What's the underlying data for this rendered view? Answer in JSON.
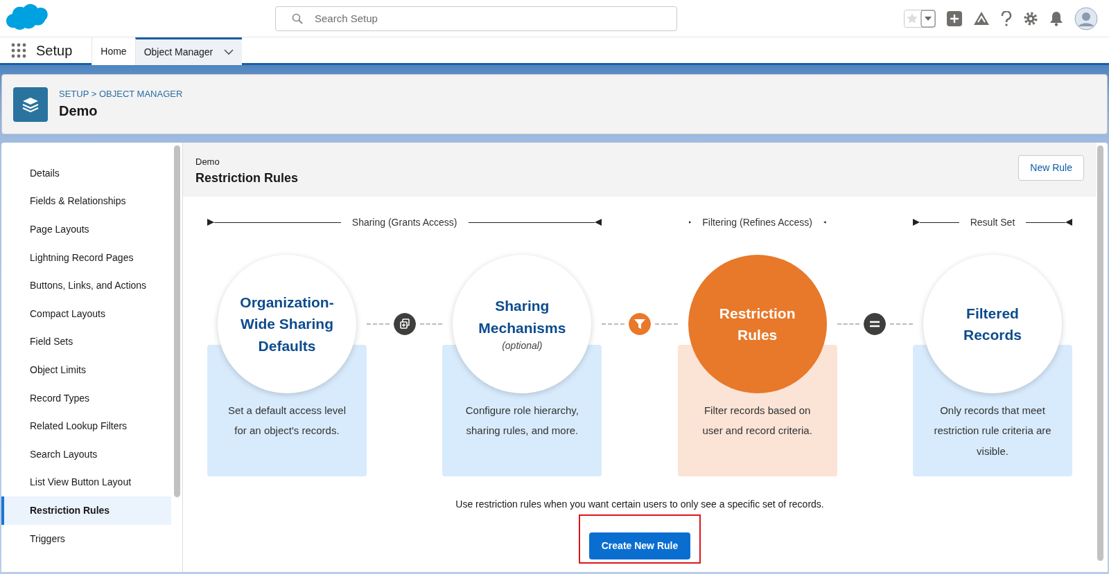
{
  "header": {
    "search": {
      "placeholder": "Search Setup"
    }
  },
  "app_bar": {
    "app_name": "Setup",
    "tabs": [
      {
        "label": "Home",
        "selected": false,
        "dropdown": false
      },
      {
        "label": "Object Manager",
        "selected": true,
        "dropdown": true
      }
    ]
  },
  "page_header": {
    "breadcrumb": "SETUP > OBJECT MANAGER",
    "title": "Demo"
  },
  "sidebar": {
    "items": [
      {
        "label": "Details",
        "selected": false
      },
      {
        "label": "Fields & Relationships",
        "selected": false
      },
      {
        "label": "Page Layouts",
        "selected": false
      },
      {
        "label": "Lightning Record Pages",
        "selected": false
      },
      {
        "label": "Buttons, Links, and Actions",
        "selected": false
      },
      {
        "label": "Compact Layouts",
        "selected": false
      },
      {
        "label": "Field Sets",
        "selected": false
      },
      {
        "label": "Object Limits",
        "selected": false
      },
      {
        "label": "Record Types",
        "selected": false
      },
      {
        "label": "Related Lookup Filters",
        "selected": false
      },
      {
        "label": "Search Layouts",
        "selected": false
      },
      {
        "label": "List View Button Layout",
        "selected": false
      },
      {
        "label": "Restriction Rules",
        "selected": true
      },
      {
        "label": "Triggers",
        "selected": false
      }
    ]
  },
  "content": {
    "object": "Demo",
    "title": "Restriction Rules",
    "new_button": "New Rule",
    "diagram": {
      "ranges": [
        {
          "label": "Sharing (Grants Access)",
          "kind": "line"
        },
        {
          "label": "Filtering (Refines Access)",
          "kind": "short"
        },
        {
          "label": "Result Set",
          "kind": "line"
        }
      ],
      "stages": [
        {
          "title": "Organization-Wide Sharing Defaults",
          "description": "Set a default access level for an object's records.",
          "highlighted": false
        },
        {
          "title": "Sharing Mechanisms",
          "subtitle": "(optional)",
          "description": "Configure role hierarchy, sharing rules, and more.",
          "highlighted": false
        },
        {
          "title": "Restriction Rules",
          "description": "Filter records based on user and record criteria.",
          "highlighted": true
        },
        {
          "title": "Filtered Records",
          "description": "Only records that meet restriction rule criteria are visible.",
          "highlighted": false
        }
      ],
      "connectors": [
        {
          "kind": "plus"
        },
        {
          "kind": "filter"
        },
        {
          "kind": "equals"
        }
      ]
    },
    "note": "Use restriction rules when you want certain users to only see a specific set of records.",
    "create_button": {
      "label": "Create New Rule",
      "annotated": true
    }
  }
}
